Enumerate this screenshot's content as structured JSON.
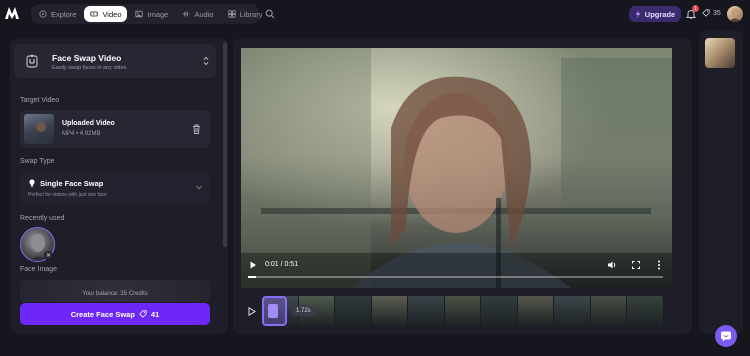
{
  "nav": {
    "tabs": [
      {
        "label": "Explore",
        "icon": "compass-icon"
      },
      {
        "label": "Video",
        "icon": "video-icon",
        "active": true
      },
      {
        "label": "Image",
        "icon": "image-icon"
      },
      {
        "label": "Audio",
        "icon": "audio-icon"
      },
      {
        "label": "Library",
        "icon": "library-icon"
      }
    ],
    "upgrade_label": "Upgrade",
    "notification_count": "1",
    "credits": "35"
  },
  "panel": {
    "mode_title": "Face Swap Video",
    "mode_subtitle": "Easily swap faces in any video",
    "target_label": "Target Video",
    "video_name": "Uploaded Video",
    "video_meta": "MP4 • 4.92MB",
    "swap_type_label": "Swap Type",
    "swap_type_title": "Single Face Swap",
    "swap_type_sub": "Perfect for videos with just one face",
    "recent_label": "Recently used",
    "face_image_label": "Face Image",
    "balance_text": "Your balance: 35 Credits",
    "create_label": "Create Face Swap",
    "create_cost": "41"
  },
  "player": {
    "time": "0:01 / 0:51",
    "progress": 0.02
  },
  "timeline": {
    "chip": "1.72s",
    "frames": 11
  },
  "colors": {
    "accent": "#6d28f7",
    "accent_light": "#8b6cf5",
    "bg": "#16161f",
    "panel": "#1e1e29"
  }
}
